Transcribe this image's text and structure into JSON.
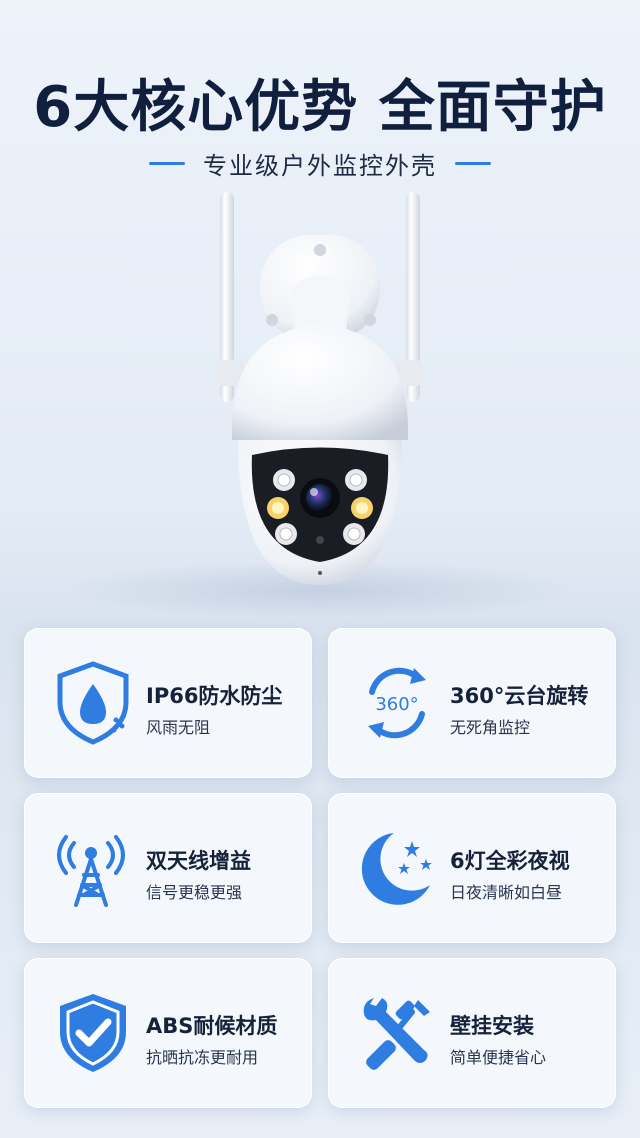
{
  "header": {
    "title": "6大核心优势 全面守护",
    "subtitle": "专业级户外监控外壳"
  },
  "features": [
    {
      "icon": "water-shield-icon",
      "title": "IP66防水防尘",
      "desc": "风雨无阻"
    },
    {
      "icon": "rotate-360-icon",
      "title": "360°云台旋转",
      "desc": "无死角监控",
      "badge": "360°"
    },
    {
      "icon": "antenna-tower-icon",
      "title": "双天线增益",
      "desc": "信号更稳更强"
    },
    {
      "icon": "moon-stars-icon",
      "title": "6灯全彩夜视",
      "desc": "日夜清晰如白昼"
    },
    {
      "icon": "check-shield-icon",
      "title": "ABS耐候材质",
      "desc": "抗晒抗冻更耐用"
    },
    {
      "icon": "tools-icon",
      "title": "壁挂安装",
      "desc": "简单便捷省心"
    }
  ],
  "colors": {
    "accent": "#2f7de1",
    "title": "#0f1f3d",
    "card": "#f4f7fc"
  }
}
